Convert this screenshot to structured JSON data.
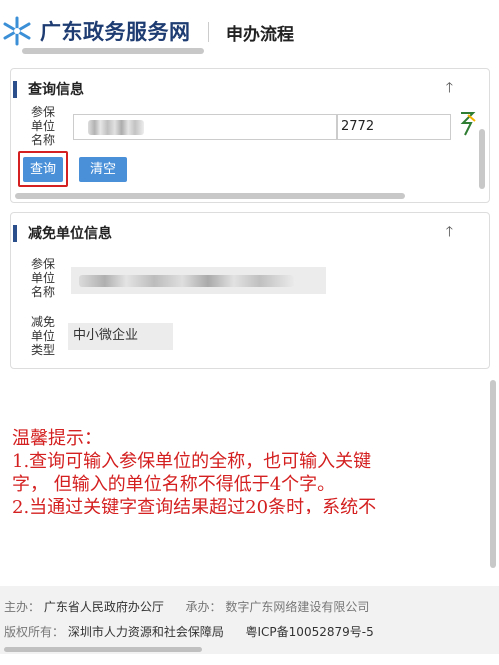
{
  "header": {
    "site_title": "广东政务服务网",
    "page_title": "申办流程"
  },
  "query_card": {
    "title": "查询信息",
    "collapse_icon": "arrow-up-icon",
    "name_label": [
      "参保",
      "单位",
      "名称"
    ],
    "name_value_blurred": true,
    "code_value": "2772",
    "query_button": "查询",
    "clear_button": "清空"
  },
  "result_card": {
    "title": "减免单位信息",
    "collapse_icon": "arrow-up-icon",
    "unit_name_label": [
      "参保",
      "单位",
      "名称"
    ],
    "unit_name_blurred": true,
    "unit_type_label": [
      "减免",
      "单位",
      "类型"
    ],
    "unit_type_value": "中小微企业"
  },
  "notice": {
    "line1": "温馨提示：",
    "line2": "1.查询可输入参保单位的全称，也可输入关键",
    "line3": "字，  但输入的单位名称不得低于4个字。",
    "line4": "2.当通过关键字查询结果超过20条时，系统不"
  },
  "footer": {
    "host_label": "主办：",
    "host_value": "广东省人民政府办公厅",
    "operator_label": "承办：",
    "operator_value": "数字广东网络建设有限公司",
    "copyright_label": "版权所有：",
    "copyright_value": "深圳市人力资源和社会保障局",
    "icp": "粤ICP备10052879号-5"
  },
  "colors": {
    "brand_blue": "#1e3c72",
    "button_blue": "#4a90d9",
    "notice_red": "#d42020",
    "highlight_red": "#d42020"
  }
}
